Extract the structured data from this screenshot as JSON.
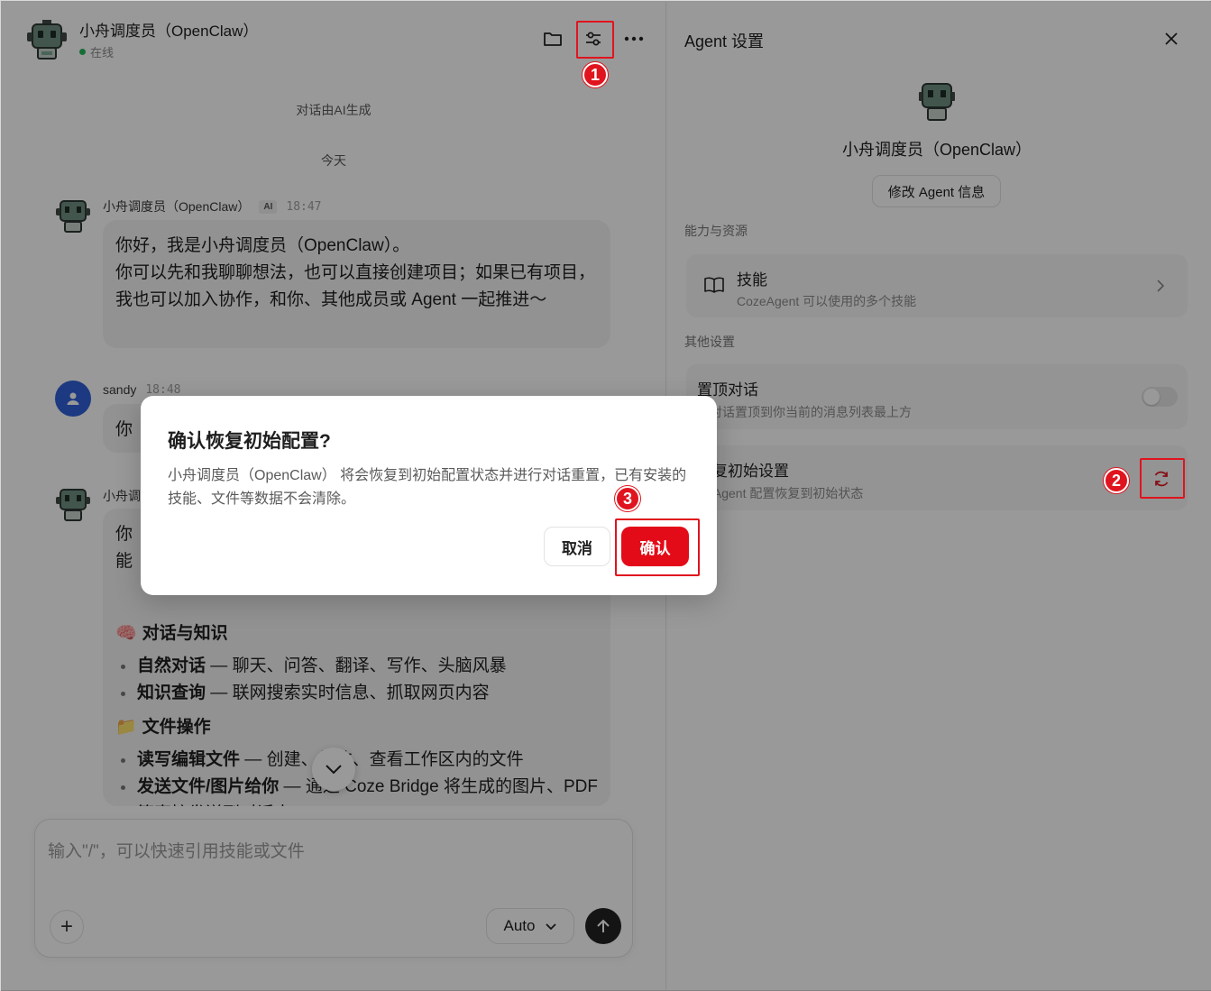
{
  "chat": {
    "header": {
      "bot_name": "小舟调度员（OpenClaw）",
      "status": "在线"
    },
    "notices": {
      "ai_generated": "对话由AI生成",
      "today": "今天"
    },
    "messages": [
      {
        "sender": "小舟调度员（OpenClaw）",
        "tag": "AI",
        "time": "18:47",
        "text": "你好，我是小舟调度员（OpenClaw）。\n你可以先和我聊聊想法，也可以直接创建项目；如果已有项目，我也可以加入协作，和你、其他成员或 Agent 一起推进～"
      },
      {
        "sender": "sandy",
        "time": "18:48",
        "text": "你"
      },
      {
        "sender": "小舟调",
        "text_partial": [
          "你",
          "能"
        ],
        "sections": [
          {
            "icon": "🧠",
            "heading": "对话与知识",
            "items": [
              {
                "bold": "自然对话",
                "text": " — 聊天、问答、翻译、写作、头脑风暴"
              },
              {
                "bold": "知识查询",
                "text": " — 联网搜索实时信息、抓取网页内容"
              }
            ]
          },
          {
            "icon": "📁",
            "heading": "文件操作",
            "items": [
              {
                "bold": "读写编辑文件",
                "text": " — 创建、修改、查看工作区内的文件"
              },
              {
                "bold": "发送文件/图片给你",
                "text": " — 通过 Coze Bridge 将生成的图片、PDF 等直接发送到对话中"
              }
            ]
          }
        ]
      }
    ],
    "composer": {
      "placeholder": "输入\"/\"，可以快速引用技能或文件",
      "model": "Auto",
      "plus": "+"
    }
  },
  "settings": {
    "title": "Agent 设置",
    "bot_name": "小舟调度员（OpenClaw）",
    "edit_button": "修改 Agent 信息",
    "section_capabilities": "能力与资源",
    "skills": {
      "title": "技能",
      "subtitle": "CozeAgent 可以使用的多个技能"
    },
    "section_other": "其他设置",
    "pin": {
      "title": "置顶对话",
      "subtitle": "将对话置顶到你当前的消息列表最上方",
      "enabled": false
    },
    "reset": {
      "title": "恢复初始设置",
      "subtitle": "将 Agent 配置恢复到初始状态"
    }
  },
  "modal": {
    "title": "确认恢复初始配置?",
    "body": "小舟调度员（OpenClaw） 将会恢复到初始配置状态并进行对话重置，已有安装的技能、文件等数据不会清除。",
    "cancel": "取消",
    "confirm": "确认"
  },
  "annotations": {
    "step1": "1",
    "step2": "2",
    "step3": "3",
    "color": "#e0141e"
  }
}
